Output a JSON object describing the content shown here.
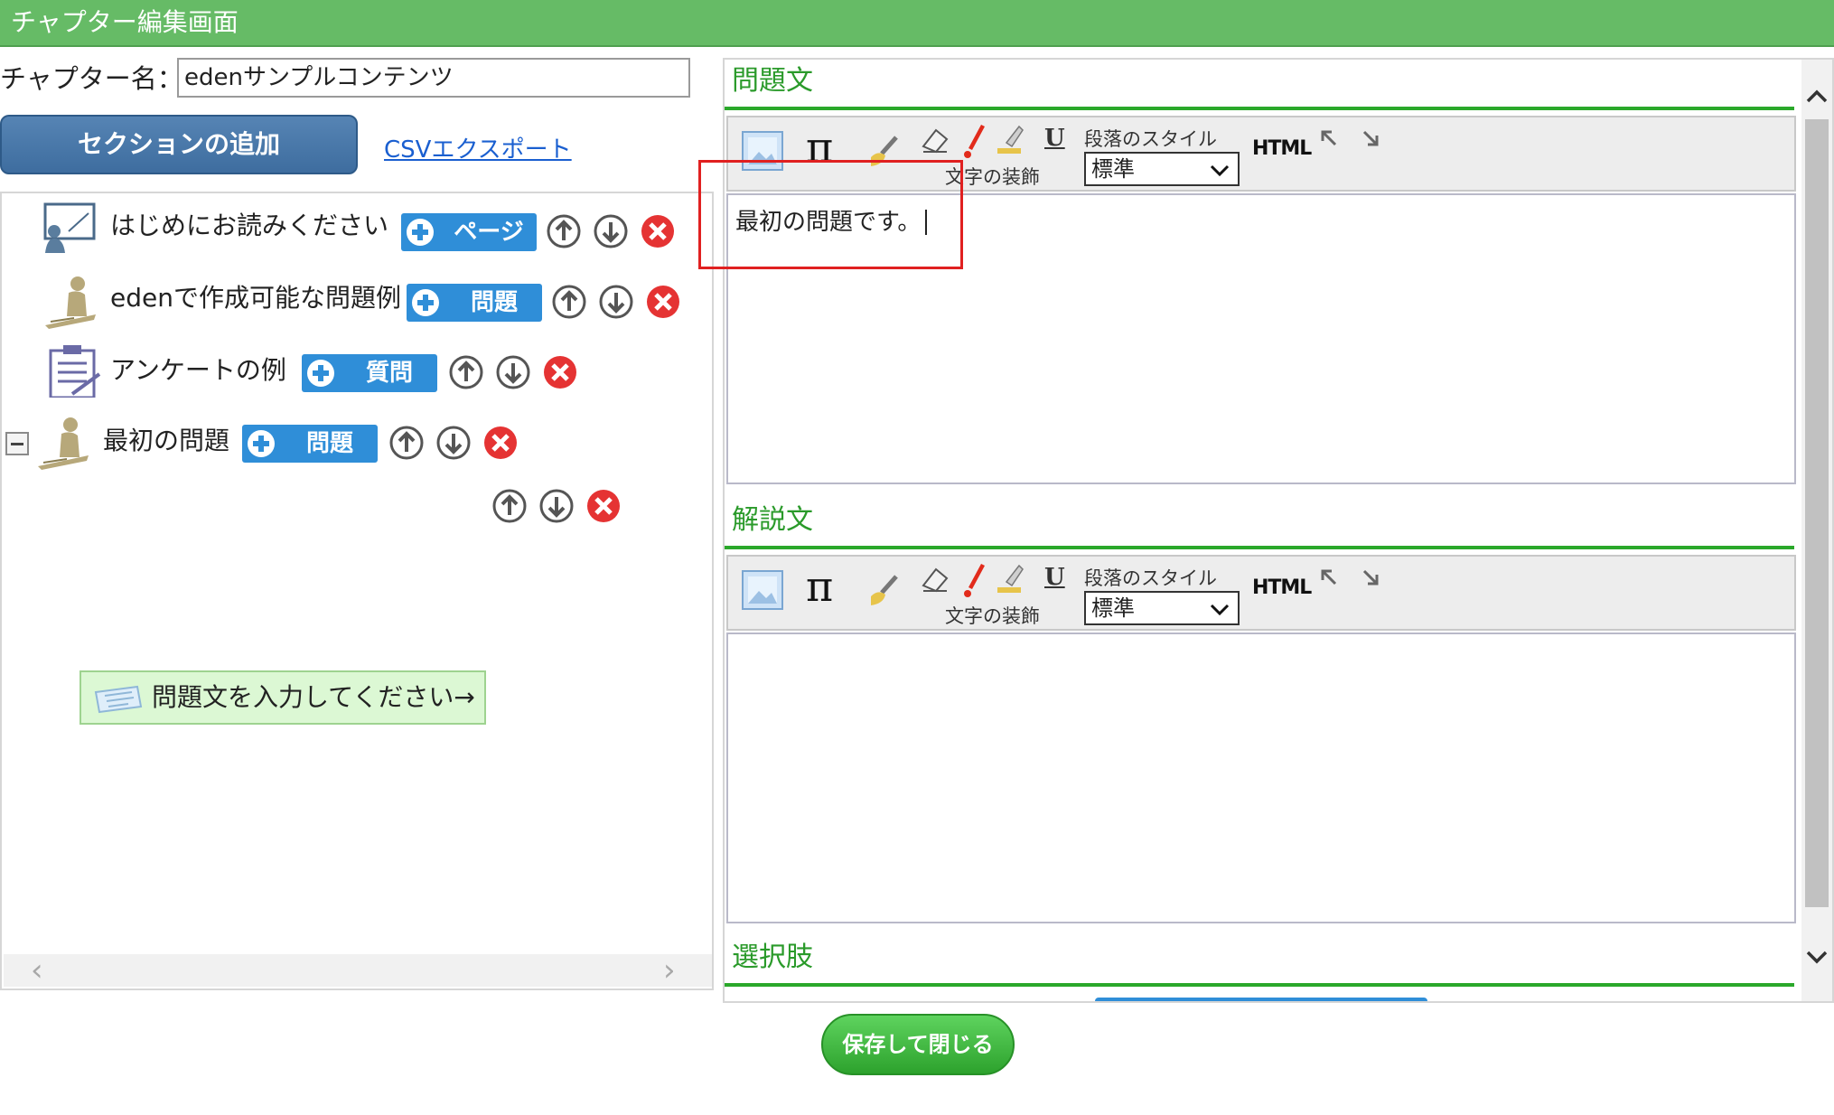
{
  "window": {
    "title": "チャプター編集画面"
  },
  "chapter": {
    "label": "チャプター名：",
    "name": "edenサンプルコンテンツ"
  },
  "actions": {
    "add_section": "セクションの追加",
    "csv_export": "CSVエクスポート",
    "save_close": "保存して閉じる"
  },
  "tree": {
    "items": [
      {
        "label": "はじめにお読みください",
        "tag": "ページ",
        "icon": "presentation-board-icon"
      },
      {
        "label": "edenで作成可能な問題例",
        "tag": "問題",
        "icon": "person-writing-icon"
      },
      {
        "label": "アンケートの例",
        "tag": "質問",
        "icon": "clipboard-icon"
      },
      {
        "label": "最初の問題",
        "tag": "問題",
        "icon": "person-writing-icon",
        "expanded": true
      }
    ],
    "child_item": {
      "label": "問題文を入力してください→"
    }
  },
  "editor": {
    "sections": [
      {
        "title": "問題文",
        "content": "最初の問題です。"
      },
      {
        "title": "解説文",
        "content": ""
      },
      {
        "title": "選択肢"
      }
    ],
    "toolbar": {
      "decoration_label": "文字の装飾",
      "paragraph_label": "段落のスタイル",
      "paragraph_value": "標準",
      "html_label": "HTML",
      "underline_label": "U"
    }
  },
  "colors": {
    "accent_green": "#66bb66",
    "heading_green": "#2a9a2a",
    "button_blue": "#3e6d9f",
    "tag_blue": "#2f8ed8",
    "annotation_red": "#e02020"
  }
}
